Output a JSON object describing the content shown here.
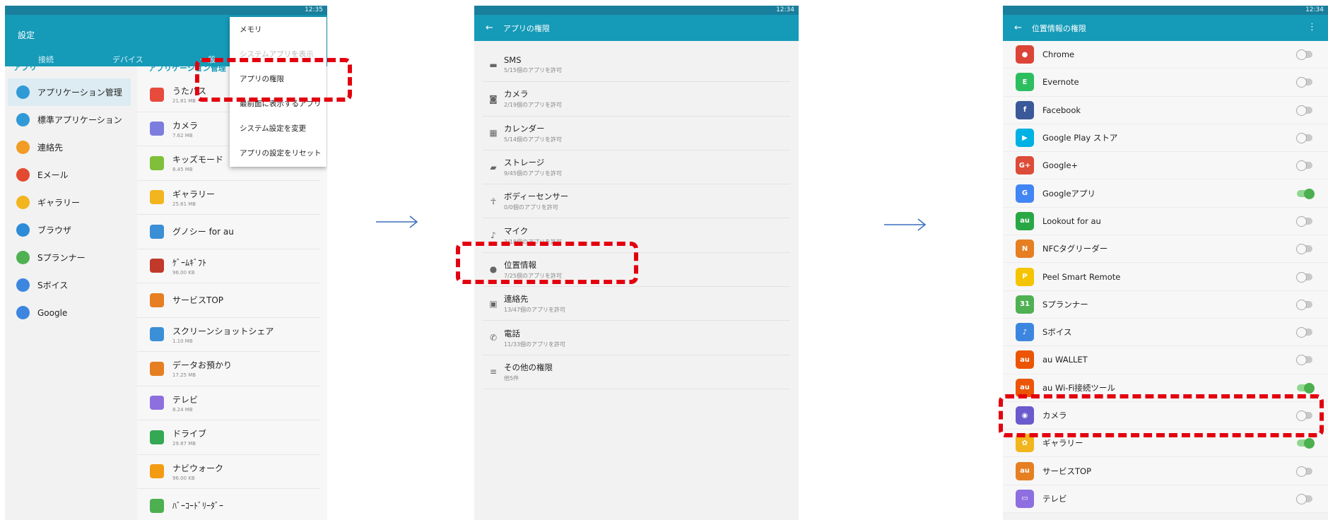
{
  "screen1": {
    "status": "12:35",
    "title": "設定",
    "tabs": [
      "接続",
      "デバイス",
      "一般"
    ],
    "section": "アプリ",
    "right_header": "アプリケーション管理",
    "categories": [
      {
        "label": "アプリケーション管理",
        "color": "#2f9ad6",
        "active": true
      },
      {
        "label": "標準アプリケーション",
        "color": "#2f9ad6",
        "active": false
      },
      {
        "label": "連絡先",
        "color": "#f29b25",
        "active": false
      },
      {
        "label": "Eメール",
        "color": "#e34a2f",
        "active": false
      },
      {
        "label": "ギャラリー",
        "color": "#f2b51e",
        "active": false
      },
      {
        "label": "ブラウザ",
        "color": "#2d8bd8",
        "active": false
      },
      {
        "label": "Sプランナー",
        "color": "#4fb152",
        "active": false
      },
      {
        "label": "Sボイス",
        "color": "#3d86e0",
        "active": false
      },
      {
        "label": "Google",
        "color": "#3d86e0",
        "active": false
      }
    ],
    "apps": [
      {
        "name": "うたパス",
        "size": "21.81 MB",
        "color": "#e74b3c"
      },
      {
        "name": "カメラ",
        "size": "7.62 MB",
        "color": "#7d7de0"
      },
      {
        "name": "キッズモード",
        "size": "8.45 MB",
        "color": "#7fbf3a"
      },
      {
        "name": "ギャラリー",
        "size": "25.61 MB",
        "color": "#f2b51e"
      },
      {
        "name": "グノシー for au",
        "size": "",
        "color": "#3a8fd6"
      },
      {
        "name": "ｹﾞｰﾑｷﾞﾌﾄ",
        "size": "96.00 KB",
        "color": "#c0392b"
      },
      {
        "name": "サービスTOP",
        "size": "",
        "color": "#e67e22"
      },
      {
        "name": "スクリーンショットシェア",
        "size": "1.10 MB",
        "color": "#3a8fd6"
      },
      {
        "name": "データお預かり",
        "size": "17.25 MB",
        "color": "#e67e22"
      },
      {
        "name": "テレビ",
        "size": "8.24 MB",
        "color": "#8e6fe0"
      },
      {
        "name": "ドライブ",
        "size": "29.87 MB",
        "color": "#34a853"
      },
      {
        "name": "ナビウォーク",
        "size": "96.00 KB",
        "color": "#f39c12"
      },
      {
        "name": "ﾊﾞｰｺｰﾄﾞﾘｰﾀﾞｰ",
        "size": "",
        "color": "#4caf50"
      }
    ],
    "menu": [
      {
        "label": "メモリ",
        "disabled": false
      },
      {
        "label": "システムアプリを表示",
        "disabled": true
      },
      {
        "label": "アプリの権限",
        "disabled": false
      },
      {
        "label": "最前面に表示するアプリ",
        "disabled": false
      },
      {
        "label": "システム設定を変更",
        "disabled": false
      },
      {
        "label": "アプリの設定をリセット",
        "disabled": false
      }
    ]
  },
  "screen2": {
    "status": "12:34",
    "title": "アプリの権限",
    "permissions": [
      {
        "name": "SMS",
        "sub": "5/15個のアプリを許可",
        "icon": "▬"
      },
      {
        "name": "カメラ",
        "sub": "2/19個のアプリを許可",
        "icon": "◙"
      },
      {
        "name": "カレンダー",
        "sub": "5/14個のアプリを許可",
        "icon": "▦"
      },
      {
        "name": "ストレージ",
        "sub": "9/45個のアプリを許可",
        "icon": "▰"
      },
      {
        "name": "ボディーセンサー",
        "sub": "0/0個のアプリを許可",
        "icon": "☥"
      },
      {
        "name": "マイク",
        "sub": "3/18個のアプリを許可",
        "icon": "♪"
      },
      {
        "name": "位置情報",
        "sub": "7/25個のアプリを許可",
        "icon": "●"
      },
      {
        "name": "連絡先",
        "sub": "13/47個のアプリを許可",
        "icon": "▣"
      },
      {
        "name": "電話",
        "sub": "11/33個のアプリを許可",
        "icon": "✆"
      },
      {
        "name": "その他の権限",
        "sub": "他5件",
        "icon": "≡"
      }
    ]
  },
  "screen3": {
    "status": "12:34",
    "title": "位置情報の権限",
    "apps": [
      {
        "name": "Chrome",
        "on": false,
        "color": "#db4437",
        "glyph": "●"
      },
      {
        "name": "Evernote",
        "on": false,
        "color": "#2dbe60",
        "glyph": "E"
      },
      {
        "name": "Facebook",
        "on": false,
        "color": "#3b5998",
        "glyph": "f"
      },
      {
        "name": "Google Play ストア",
        "on": false,
        "color": "#00b1e3",
        "glyph": "▶"
      },
      {
        "name": "Google+",
        "on": false,
        "color": "#dd4b39",
        "glyph": "G+"
      },
      {
        "name": "Googleアプリ",
        "on": true,
        "color": "#4285f4",
        "glyph": "G"
      },
      {
        "name": "Lookout for au",
        "on": false,
        "color": "#29a745",
        "glyph": "au"
      },
      {
        "name": "NFCタグリーダー",
        "on": false,
        "color": "#e67e22",
        "glyph": "N"
      },
      {
        "name": "Peel Smart Remote",
        "on": false,
        "color": "#f5c400",
        "glyph": "P"
      },
      {
        "name": "Sプランナー",
        "on": false,
        "color": "#4fb152",
        "glyph": "31"
      },
      {
        "name": "Sボイス",
        "on": false,
        "color": "#3d86e0",
        "glyph": "♪"
      },
      {
        "name": "au WALLET",
        "on": false,
        "color": "#eb5505",
        "glyph": "au"
      },
      {
        "name": "au Wi-Fi接続ツール",
        "on": true,
        "color": "#eb5505",
        "glyph": "au"
      },
      {
        "name": "カメラ",
        "on": false,
        "color": "#6a5acd",
        "glyph": "◉"
      },
      {
        "name": "ギャラリー",
        "on": true,
        "color": "#f2b51e",
        "glyph": "✿"
      },
      {
        "name": "サービスTOP",
        "on": false,
        "color": "#e67e22",
        "glyph": "au"
      },
      {
        "name": "テレビ",
        "on": false,
        "color": "#8e6fe0",
        "glyph": "▭"
      }
    ]
  }
}
